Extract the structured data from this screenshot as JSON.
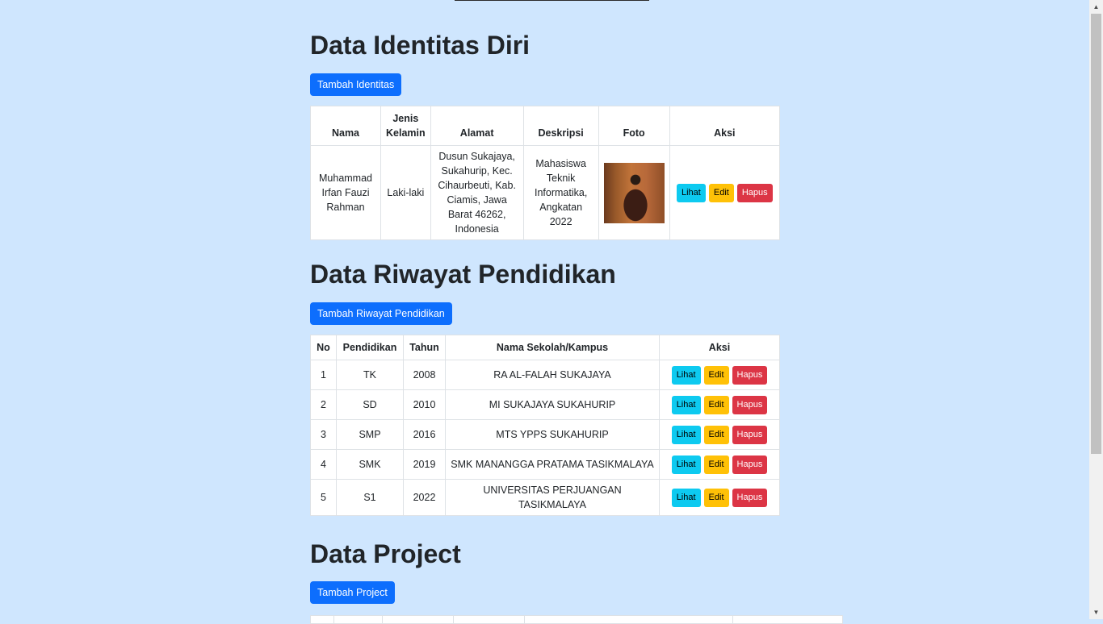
{
  "identitas": {
    "title": "Data Identitas Diri",
    "add_button": "Tambah Identitas",
    "headers": [
      "Nama",
      "Jenis Kelamin",
      "Alamat",
      "Deskripsi",
      "Foto",
      "Aksi"
    ],
    "row": {
      "nama": "Muhammad Irfan Fauzi Rahman",
      "jenis_kelamin": "Laki-laki",
      "alamat": "Dusun Sukajaya, Sukahurip, Kec. Cihaurbeuti, Kab. Ciamis, Jawa Barat 46262, Indonesia",
      "deskripsi": "Mahasiswa Teknik Informatika, Angkatan 2022"
    }
  },
  "pendidikan": {
    "title": "Data Riwayat Pendidikan",
    "add_button": "Tambah Riwayat Pendidikan",
    "headers": [
      "No",
      "Pendidikan",
      "Tahun",
      "Nama Sekolah/Kampus",
      "Aksi"
    ],
    "rows": [
      {
        "no": "1",
        "pendidikan": "TK",
        "tahun": "2008",
        "nama": "RA AL-FALAH SUKAJAYA"
      },
      {
        "no": "2",
        "pendidikan": "SD",
        "tahun": "2010",
        "nama": "MI SUKAJAYA SUKAHURIP"
      },
      {
        "no": "3",
        "pendidikan": "SMP",
        "tahun": "2016",
        "nama": "MTS YPPS SUKAHURIP"
      },
      {
        "no": "4",
        "pendidikan": "SMK",
        "tahun": "2019",
        "nama": "SMK MANANGGA PRATAMA TASIKMALAYA"
      },
      {
        "no": "5",
        "pendidikan": "S1",
        "tahun": "2022",
        "nama": "UNIVERSITAS PERJUANGAN TASIKMALAYA"
      }
    ]
  },
  "project": {
    "title": "Data Project",
    "add_button": "Tambah Project"
  },
  "actions": {
    "view": "Lihat",
    "edit": "Edit",
    "delete": "Hapus"
  },
  "colors": {
    "background": "#cfe6fe",
    "primary": "#0d6efd",
    "info": "#0dcaf0",
    "warning": "#ffc107",
    "danger": "#dc3545"
  }
}
